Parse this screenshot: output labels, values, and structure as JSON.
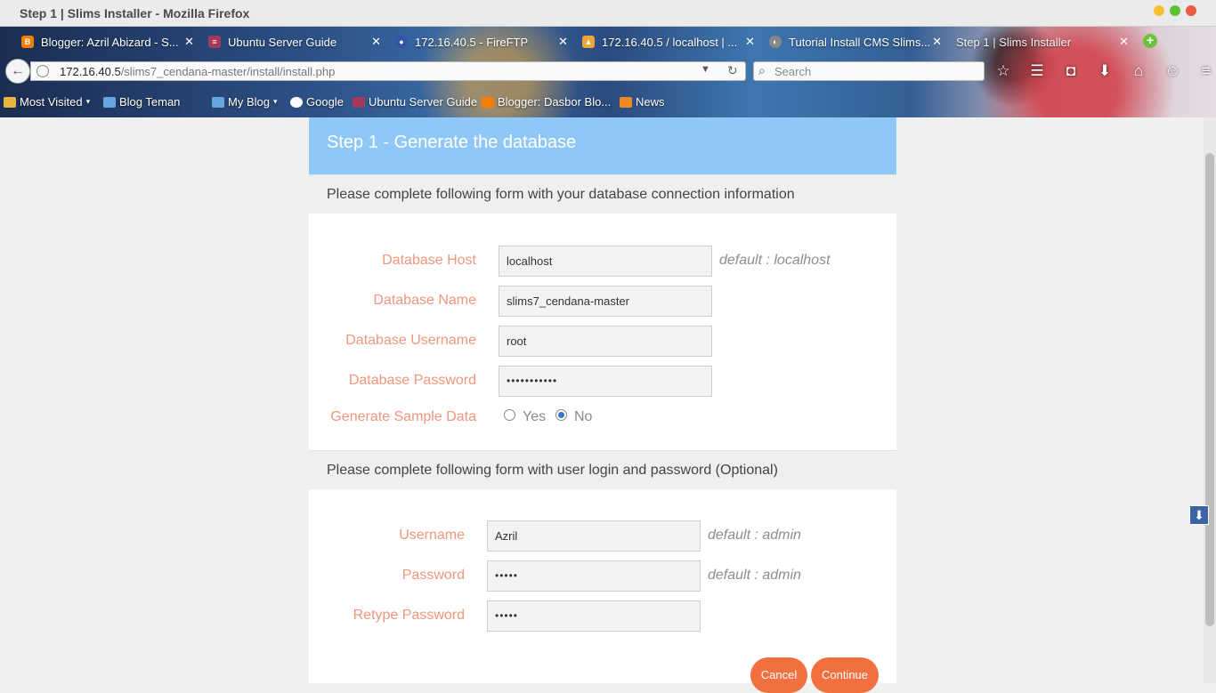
{
  "window": {
    "title": "Step 1 | Slims Installer - Mozilla Firefox"
  },
  "tabs": [
    {
      "label": "Blogger: Azril Abizard - S...",
      "icon": "blogger-icon",
      "color": "#f57d00"
    },
    {
      "label": "Ubuntu Server Guide",
      "icon": "ubuntu-icon",
      "color": "#a33a5c"
    },
    {
      "label": "172.16.40.5 - FireFTP",
      "icon": "fireftp-icon",
      "color": "#3355aa"
    },
    {
      "label": "172.16.40.5 / localhost | ...",
      "icon": "phpmyadmin-icon",
      "color": "#e8a83a"
    },
    {
      "label": "Tutorial Install CMS Slims...",
      "icon": "cms-icon",
      "color": "#888888"
    },
    {
      "label": "Step 1 | Slims Installer",
      "icon": "page-icon",
      "color": "#cccccc"
    }
  ],
  "nav": {
    "url_host": "172.16.40.5",
    "url_path": "/slims7_cendana-master/install/install.php",
    "search_placeholder": "Search"
  },
  "bookmarks": [
    {
      "label": "Most Visited",
      "dropdown": "▾"
    },
    {
      "label": "Blog Teman"
    },
    {
      "label": "My Blog",
      "dropdown": "▾"
    },
    {
      "label": "Google"
    },
    {
      "label": "Ubuntu Server Guide"
    },
    {
      "label": "Blogger: Dasbor Blo..."
    },
    {
      "label": "News"
    }
  ],
  "installer": {
    "step_title": "Step 1 - Generate the database",
    "db_section": "Please complete following form with your database connection information",
    "db_host": {
      "label": "Database Host",
      "value": "localhost",
      "hint": "default : localhost"
    },
    "db_name": {
      "label": "Database Name",
      "value": "slims7_cendana-master"
    },
    "db_user": {
      "label": "Database Username",
      "value": "root"
    },
    "db_pass": {
      "label": "Database Password",
      "value": "•••••••••••"
    },
    "sample": {
      "label": "Generate Sample Data",
      "yes": "Yes",
      "no": "No",
      "selected": "No"
    },
    "user_section": "Please complete following form with user login and password (Optional)",
    "username": {
      "label": "Username",
      "value": "Azril",
      "hint": "default : admin"
    },
    "password": {
      "label": "Password",
      "value": "•••••",
      "hint": "default : admin"
    },
    "retype": {
      "label": "Retype Password",
      "value": "•••••"
    },
    "cancel": "Cancel",
    "continue": "Continue"
  }
}
